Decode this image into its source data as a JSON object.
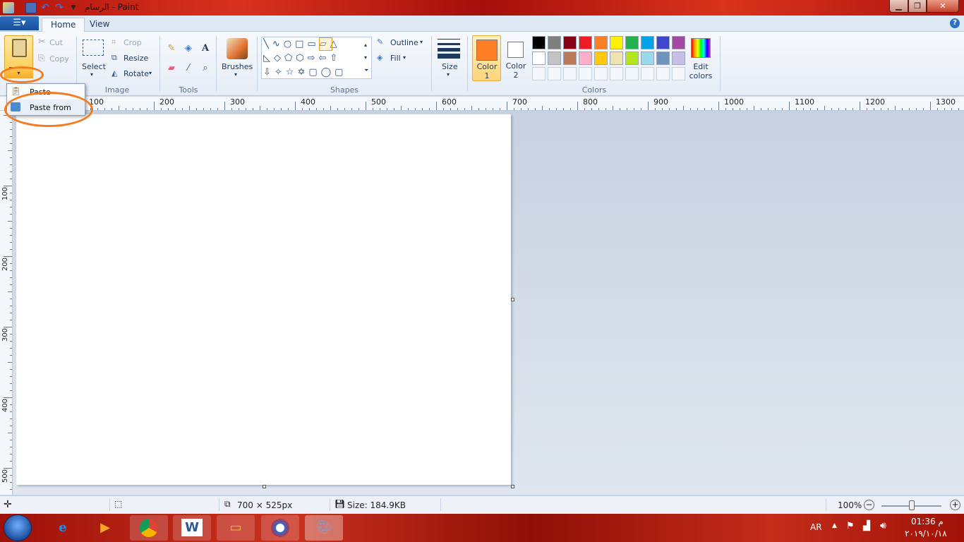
{
  "titlebar": {
    "title": "الرسام - Paint",
    "minimize": "▁",
    "maximize": "❐",
    "close": "✕"
  },
  "tabs": {
    "home": "Home",
    "view": "View",
    "help": "?"
  },
  "clipboard": {
    "paste": "Paste",
    "cut": "Cut",
    "copy": "Copy"
  },
  "image": {
    "select": "Select",
    "crop": "Crop",
    "resize": "Resize",
    "rotate": "Rotate",
    "label": "Image"
  },
  "tools": {
    "label": "Tools"
  },
  "brushes": {
    "label": "Brushes"
  },
  "shapes": {
    "outline": "Outline",
    "fill": "Fill",
    "label": "Shapes"
  },
  "size": {
    "label": "Size"
  },
  "colors": {
    "color1_label": "Color 1",
    "color2_label": "Color 2",
    "edit_label": "Edit colors",
    "label": "Colors",
    "color1": "#ff7f27",
    "color2": "#ffffff",
    "row1": [
      "#000000",
      "#7f7f7f",
      "#880015",
      "#ed1c24",
      "#ff7f27",
      "#fff200",
      "#22b14c",
      "#00a2e8",
      "#3f48cc",
      "#a349a4"
    ],
    "row2": [
      "#ffffff",
      "#c3c3c3",
      "#b97a57",
      "#ffaec9",
      "#ffc90e",
      "#efe4b0",
      "#b5e61d",
      "#99d9ea",
      "#7092be",
      "#c8bfe7"
    ]
  },
  "ruler_h": [
    "100",
    "200",
    "300",
    "400",
    "500",
    "600",
    "700",
    "800",
    "900",
    "1000",
    "1100",
    "1200",
    "1300"
  ],
  "ruler_v": [
    "100",
    "200",
    "300",
    "400",
    "500"
  ],
  "paste_menu": {
    "paste": "Paste",
    "paste_from": "Paste from"
  },
  "status": {
    "dimensions": "700 × 525px",
    "size": "Size: 184.9KB",
    "zoom": "100%"
  },
  "taskbar": {
    "lang": "AR",
    "time": "01:36 م",
    "date": "٢٠١٩/١٠/١٨"
  },
  "accent": "#f47b20"
}
